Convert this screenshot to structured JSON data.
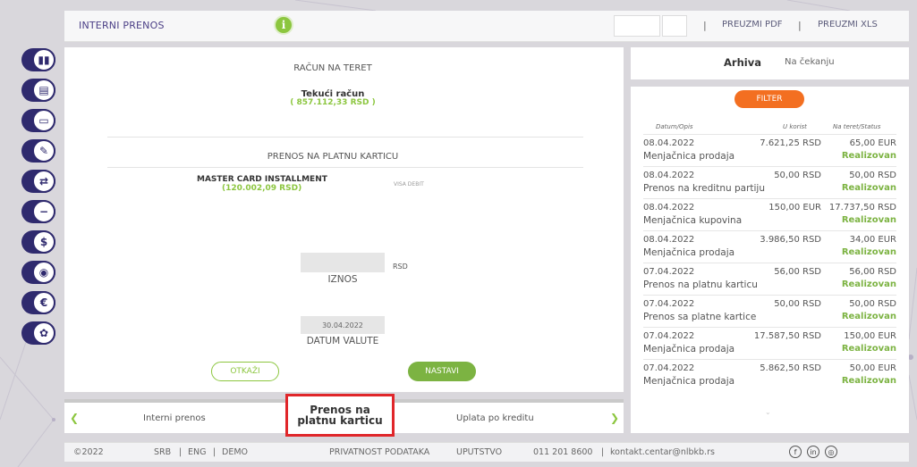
{
  "header": {
    "title": "INTERNI PRENOS",
    "info_glyph": "i",
    "pdf_label": "PREUZMI PDF",
    "xls_label": "PREUZMI XLS",
    "separator": "|"
  },
  "sidebar": {
    "items": [
      {
        "icon": "bar-chart-icon",
        "glyph": "▮▮"
      },
      {
        "icon": "documents-icon",
        "glyph": "▤"
      },
      {
        "icon": "card-icon",
        "glyph": "▭"
      },
      {
        "icon": "feather-icon",
        "glyph": "✎"
      },
      {
        "icon": "transfer-icon",
        "glyph": "⇄"
      },
      {
        "icon": "minus-card-icon",
        "glyph": "−"
      },
      {
        "icon": "dollar-icon",
        "glyph": "$"
      },
      {
        "icon": "location-icon",
        "glyph": "◉"
      },
      {
        "icon": "euro-icon",
        "glyph": "€"
      },
      {
        "icon": "settings-icon",
        "glyph": "✿"
      }
    ]
  },
  "form": {
    "debit_heading": "RAČUN NA TERET",
    "account_name": "Tekući račun",
    "account_balance": "( 857.112,33 RSD )",
    "transfer_heading": "PRENOS NA PLATNU KARTICU",
    "card_name": "MASTER CARD INSTALLMENT",
    "card_balance": "(120.002,09 RSD)",
    "card_dropdown": "VISA DEBIT",
    "currency": "RSD",
    "amount_label": "IZNOS",
    "amount_value": "",
    "date_value": "30.04.2022",
    "date_label": "DATUM VALUTE",
    "cancel_label": "OTKAŽI",
    "continue_label": "NASTAVI"
  },
  "carousel": {
    "prev": "Interni prenos",
    "active_line1": "Prenos na",
    "active_line2": "platnu karticu",
    "next": "Uplata po kreditu"
  },
  "archive": {
    "tab_active": "Arhiva",
    "tab_pending": "Na čekanju",
    "filter_label": "FILTER",
    "col_date": "Datum/Opis",
    "col_credit": "U korist",
    "col_debit": "Na teret/Status",
    "rows": [
      {
        "date": "08.04.2022",
        "credit": "7.621,25 RSD",
        "debit": "65,00 EUR",
        "desc": "Menjačnica prodaja",
        "status": "Realizovan"
      },
      {
        "date": "08.04.2022",
        "credit": "50,00 RSD",
        "debit": "50,00 RSD",
        "desc": "Prenos na kreditnu partiju",
        "status": "Realizovan"
      },
      {
        "date": "08.04.2022",
        "credit": "150,00 EUR",
        "debit": "17.737,50 RSD",
        "desc": "Menjačnica kupovina",
        "status": "Realizovan"
      },
      {
        "date": "08.04.2022",
        "credit": "3.986,50 RSD",
        "debit": "34,00 EUR",
        "desc": "Menjačnica prodaja",
        "status": "Realizovan"
      },
      {
        "date": "07.04.2022",
        "credit": "56,00 RSD",
        "debit": "56,00 RSD",
        "desc": "Prenos na platnu karticu",
        "status": "Realizovan"
      },
      {
        "date": "07.04.2022",
        "credit": "50,00 RSD",
        "debit": "50,00 RSD",
        "desc": "Prenos sa platne kartice",
        "status": "Realizovan"
      },
      {
        "date": "07.04.2022",
        "credit": "17.587,50 RSD",
        "debit": "150,00 EUR",
        "desc": "Menjačnica prodaja",
        "status": "Realizovan"
      },
      {
        "date": "07.04.2022",
        "credit": "5.862,50 RSD",
        "debit": "50,00 EUR",
        "desc": "Menjačnica prodaja",
        "status": "Realizovan"
      }
    ]
  },
  "footer": {
    "copyright": "©2022",
    "lang_srb": "SRB",
    "lang_eng": "ENG",
    "demo": "DEMO",
    "privacy": "PRIVATNOST PODATAKA",
    "instructions": "UPUTSTVO",
    "phone": "011 201 8600",
    "email": "kontakt.centar@nlbkb.rs",
    "sep": "|"
  },
  "colors": {
    "brand_purple": "#2f2a6e",
    "accent_green": "#8cc63f",
    "filter_orange": "#f36f21",
    "highlight_red": "#e0262a"
  }
}
